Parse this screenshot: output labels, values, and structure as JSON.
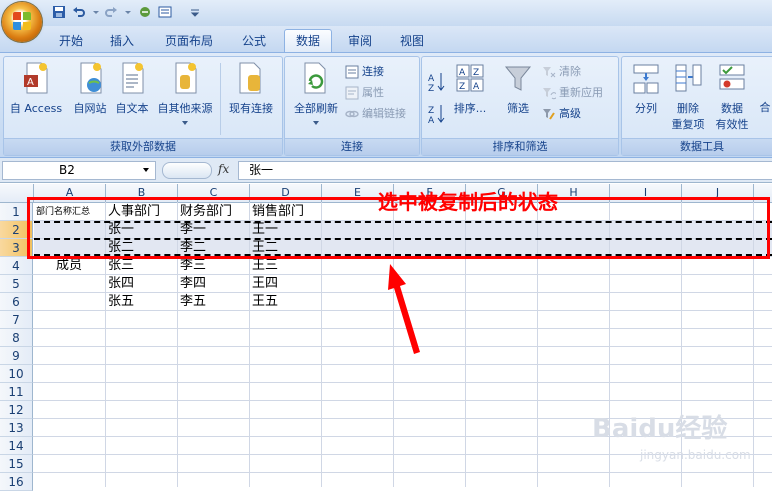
{
  "tabs": [
    "开始",
    "插入",
    "页面布局",
    "公式",
    "数据",
    "审阅",
    "视图"
  ],
  "active_tab": "数据",
  "ribbon": {
    "external_data": {
      "label": "获取外部数据",
      "buttons": [
        "自 Access",
        "自网站",
        "自文本",
        "自其他来源",
        "现有连接"
      ]
    },
    "connections": {
      "label": "连接",
      "refresh_all": "全部刷新",
      "small": [
        "连接",
        "属性",
        "编辑链接"
      ]
    },
    "sort_filter": {
      "label": "排序和筛选",
      "sort": "排序...",
      "filter": "筛选",
      "small": [
        "清除",
        "重新应用",
        "高级"
      ]
    },
    "data_tools": {
      "label": "数据工具",
      "text_to_columns": "分列",
      "remove_dup": [
        "删除",
        "重复项"
      ],
      "validation": [
        "数据",
        "有效性"
      ],
      "partial": "合"
    }
  },
  "formula_bar": {
    "name_box": "B2",
    "fx": "fx",
    "value": "张一"
  },
  "columns": [
    "A",
    "B",
    "C",
    "D",
    "E",
    "F",
    "G",
    "H",
    "I",
    "J"
  ],
  "rows": [
    "1",
    "2",
    "3",
    "4",
    "5",
    "6",
    "7",
    "8",
    "9",
    "10",
    "11",
    "12",
    "13",
    "14",
    "15",
    "16"
  ],
  "cells": {
    "a1": "部门名称汇总",
    "b1": "人事部门",
    "c1": "财务部门",
    "d1": "销售部门",
    "b2": "张一",
    "c2": "李一",
    "d2": "王一",
    "b3": "张二",
    "c3": "李二",
    "d3": "王二",
    "a4": "成员",
    "b4": "张三",
    "c4": "李三",
    "d4": "王三",
    "b5": "张四",
    "c5": "李四",
    "d5": "王四",
    "b6": "张五",
    "c6": "李五",
    "d6": "王五"
  },
  "annotation": "选中被复制后的状态",
  "watermark": "Baidu经验",
  "watermark_sub": "jingyan.baidu.com",
  "colors": {
    "accent_red": "#ff0000",
    "selection_row": "#f1c15f"
  }
}
